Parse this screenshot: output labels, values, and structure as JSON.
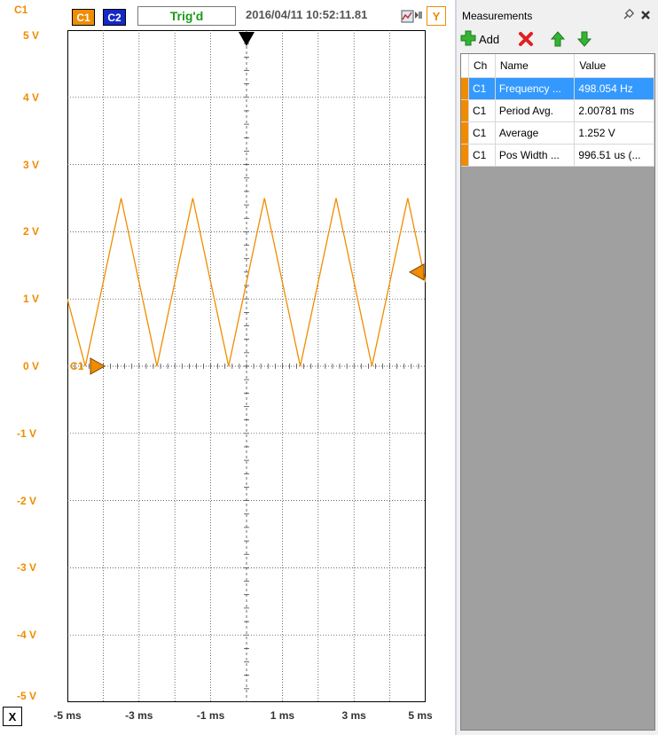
{
  "scope": {
    "channel_label": "C1",
    "c1_button": "C1",
    "c2_button": "C2",
    "trigger_status": "Trig'd",
    "timestamp": "2016/04/11 10:52:11.81",
    "y_button": "Y",
    "x_button": "X",
    "channel_marker": "C1",
    "y_ticks": [
      "5 V",
      "4 V",
      "3 V",
      "2 V",
      "1 V",
      "0 V",
      "-1 V",
      "-2 V",
      "-3 V",
      "-4 V",
      "-5 V"
    ],
    "x_ticks": [
      "-5 ms",
      "-3 ms",
      "-1 ms",
      "1 ms",
      "3 ms",
      "5 ms"
    ],
    "colors": {
      "c1": "#f08c00",
      "c2": "#1428c8",
      "trig": "#1a9a1a"
    }
  },
  "chart_data": {
    "type": "line",
    "xlabel": "",
    "ylabel": "",
    "xlim": [
      -5,
      5
    ],
    "ylim": [
      -5,
      5
    ],
    "x_unit": "ms",
    "y_unit": "V",
    "grid": true,
    "series": [
      {
        "color": "#f08c00",
        "x": [
          -5.0,
          -4.5,
          -3.5,
          -2.5,
          -1.5,
          -0.5,
          0.5,
          1.5,
          2.5,
          3.5,
          4.5,
          5.0
        ],
        "y": [
          1.0,
          0.0,
          2.5,
          0.0,
          2.5,
          0.0,
          2.5,
          0.0,
          2.5,
          0.0,
          2.5,
          1.25
        ]
      }
    ]
  },
  "measurements": {
    "title": "Measurements",
    "add_label": "Add",
    "columns": [
      "Ch",
      "Name",
      "Value"
    ],
    "rows": [
      {
        "ch": "C1",
        "name": "Frequency ...",
        "value": "498.054 Hz",
        "selected": true
      },
      {
        "ch": "C1",
        "name": "Period Avg.",
        "value": "2.00781 ms",
        "selected": false
      },
      {
        "ch": "C1",
        "name": "Average",
        "value": "1.252 V",
        "selected": false
      },
      {
        "ch": "C1",
        "name": "Pos Width ...",
        "value": "996.51 us (...",
        "selected": false
      }
    ]
  }
}
